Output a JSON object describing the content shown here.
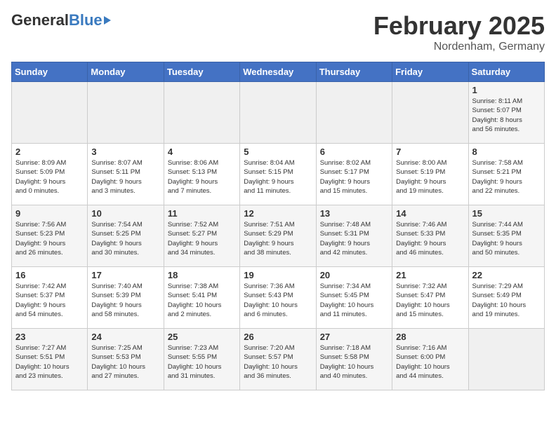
{
  "header": {
    "logo_general": "General",
    "logo_blue": "Blue",
    "title": "February 2025",
    "subtitle": "Nordenham, Germany"
  },
  "calendar": {
    "days_of_week": [
      "Sunday",
      "Monday",
      "Tuesday",
      "Wednesday",
      "Thursday",
      "Friday",
      "Saturday"
    ],
    "weeks": [
      [
        {
          "day": "",
          "info": ""
        },
        {
          "day": "",
          "info": ""
        },
        {
          "day": "",
          "info": ""
        },
        {
          "day": "",
          "info": ""
        },
        {
          "day": "",
          "info": ""
        },
        {
          "day": "",
          "info": ""
        },
        {
          "day": "1",
          "info": "Sunrise: 8:11 AM\nSunset: 5:07 PM\nDaylight: 8 hours\nand 56 minutes."
        }
      ],
      [
        {
          "day": "2",
          "info": "Sunrise: 8:09 AM\nSunset: 5:09 PM\nDaylight: 9 hours\nand 0 minutes."
        },
        {
          "day": "3",
          "info": "Sunrise: 8:07 AM\nSunset: 5:11 PM\nDaylight: 9 hours\nand 3 minutes."
        },
        {
          "day": "4",
          "info": "Sunrise: 8:06 AM\nSunset: 5:13 PM\nDaylight: 9 hours\nand 7 minutes."
        },
        {
          "day": "5",
          "info": "Sunrise: 8:04 AM\nSunset: 5:15 PM\nDaylight: 9 hours\nand 11 minutes."
        },
        {
          "day": "6",
          "info": "Sunrise: 8:02 AM\nSunset: 5:17 PM\nDaylight: 9 hours\nand 15 minutes."
        },
        {
          "day": "7",
          "info": "Sunrise: 8:00 AM\nSunset: 5:19 PM\nDaylight: 9 hours\nand 19 minutes."
        },
        {
          "day": "8",
          "info": "Sunrise: 7:58 AM\nSunset: 5:21 PM\nDaylight: 9 hours\nand 22 minutes."
        }
      ],
      [
        {
          "day": "9",
          "info": "Sunrise: 7:56 AM\nSunset: 5:23 PM\nDaylight: 9 hours\nand 26 minutes."
        },
        {
          "day": "10",
          "info": "Sunrise: 7:54 AM\nSunset: 5:25 PM\nDaylight: 9 hours\nand 30 minutes."
        },
        {
          "day": "11",
          "info": "Sunrise: 7:52 AM\nSunset: 5:27 PM\nDaylight: 9 hours\nand 34 minutes."
        },
        {
          "day": "12",
          "info": "Sunrise: 7:51 AM\nSunset: 5:29 PM\nDaylight: 9 hours\nand 38 minutes."
        },
        {
          "day": "13",
          "info": "Sunrise: 7:48 AM\nSunset: 5:31 PM\nDaylight: 9 hours\nand 42 minutes."
        },
        {
          "day": "14",
          "info": "Sunrise: 7:46 AM\nSunset: 5:33 PM\nDaylight: 9 hours\nand 46 minutes."
        },
        {
          "day": "15",
          "info": "Sunrise: 7:44 AM\nSunset: 5:35 PM\nDaylight: 9 hours\nand 50 minutes."
        }
      ],
      [
        {
          "day": "16",
          "info": "Sunrise: 7:42 AM\nSunset: 5:37 PM\nDaylight: 9 hours\nand 54 minutes."
        },
        {
          "day": "17",
          "info": "Sunrise: 7:40 AM\nSunset: 5:39 PM\nDaylight: 9 hours\nand 58 minutes."
        },
        {
          "day": "18",
          "info": "Sunrise: 7:38 AM\nSunset: 5:41 PM\nDaylight: 10 hours\nand 2 minutes."
        },
        {
          "day": "19",
          "info": "Sunrise: 7:36 AM\nSunset: 5:43 PM\nDaylight: 10 hours\nand 6 minutes."
        },
        {
          "day": "20",
          "info": "Sunrise: 7:34 AM\nSunset: 5:45 PM\nDaylight: 10 hours\nand 11 minutes."
        },
        {
          "day": "21",
          "info": "Sunrise: 7:32 AM\nSunset: 5:47 PM\nDaylight: 10 hours\nand 15 minutes."
        },
        {
          "day": "22",
          "info": "Sunrise: 7:29 AM\nSunset: 5:49 PM\nDaylight: 10 hours\nand 19 minutes."
        }
      ],
      [
        {
          "day": "23",
          "info": "Sunrise: 7:27 AM\nSunset: 5:51 PM\nDaylight: 10 hours\nand 23 minutes."
        },
        {
          "day": "24",
          "info": "Sunrise: 7:25 AM\nSunset: 5:53 PM\nDaylight: 10 hours\nand 27 minutes."
        },
        {
          "day": "25",
          "info": "Sunrise: 7:23 AM\nSunset: 5:55 PM\nDaylight: 10 hours\nand 31 minutes."
        },
        {
          "day": "26",
          "info": "Sunrise: 7:20 AM\nSunset: 5:57 PM\nDaylight: 10 hours\nand 36 minutes."
        },
        {
          "day": "27",
          "info": "Sunrise: 7:18 AM\nSunset: 5:58 PM\nDaylight: 10 hours\nand 40 minutes."
        },
        {
          "day": "28",
          "info": "Sunrise: 7:16 AM\nSunset: 6:00 PM\nDaylight: 10 hours\nand 44 minutes."
        },
        {
          "day": "",
          "info": ""
        }
      ]
    ]
  }
}
